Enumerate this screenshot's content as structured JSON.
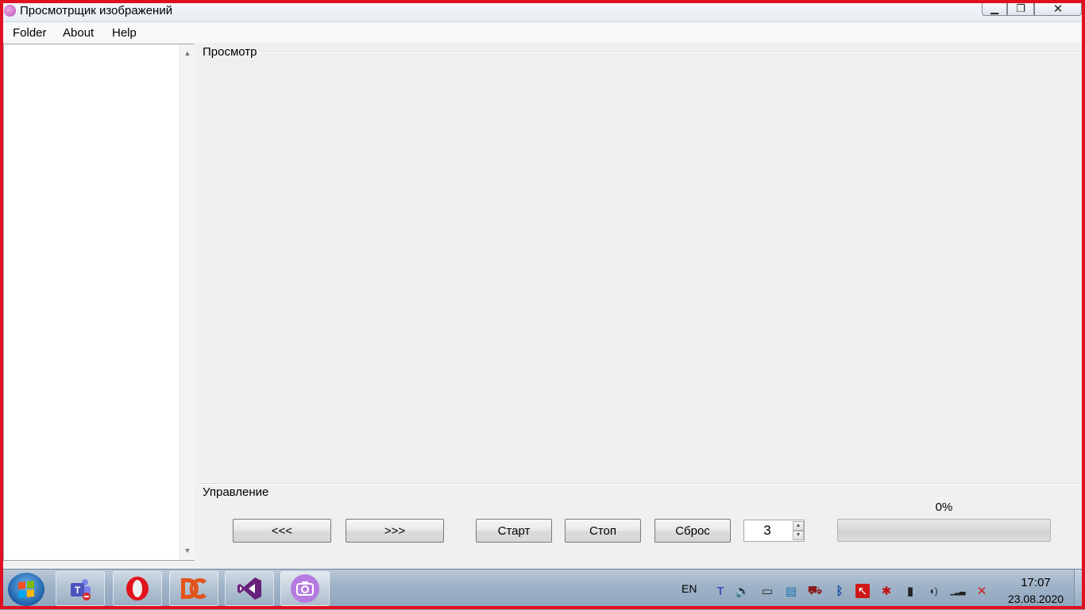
{
  "window": {
    "title": "Просмотрщик изображений",
    "minimize_glyph": "▁",
    "maximize_glyph": "❐",
    "close_glyph": "✕"
  },
  "menu": {
    "items": [
      {
        "label": "Folder"
      },
      {
        "label": "About"
      },
      {
        "label": "Help"
      }
    ]
  },
  "tree": {
    "scroll_up_glyph": "▲",
    "scroll_down_glyph": "▼"
  },
  "preview": {
    "group_label": "Просмотр"
  },
  "control": {
    "group_label": "Управление",
    "prev_label": "<<<",
    "next_label": ">>>",
    "start_label": "Старт",
    "stop_label": "Стоп",
    "reset_label": "Сброс",
    "interval_value": "3",
    "spin_up_glyph": "▲",
    "spin_down_glyph": "▼",
    "progress_text": "0%",
    "progress_fraction": 0
  },
  "taskbar": {
    "apps": [
      {
        "name": "teams-icon"
      },
      {
        "name": "opera-icon"
      },
      {
        "name": "devart-icon"
      },
      {
        "name": "visual-studio-icon"
      },
      {
        "name": "camera-icon",
        "active": true
      }
    ],
    "language": "EN",
    "clock_time": "17:07",
    "clock_date": "23.08.2020",
    "tray_glyphs": [
      "T",
      "🔈",
      "▭",
      "▤",
      "⛟",
      "ᛒ",
      "↖",
      "✱",
      "▮",
      "◖)",
      "▁▂▃",
      "✕"
    ]
  },
  "colors": {
    "frame": "#e01020",
    "progress_fill": "#3fbf36"
  }
}
